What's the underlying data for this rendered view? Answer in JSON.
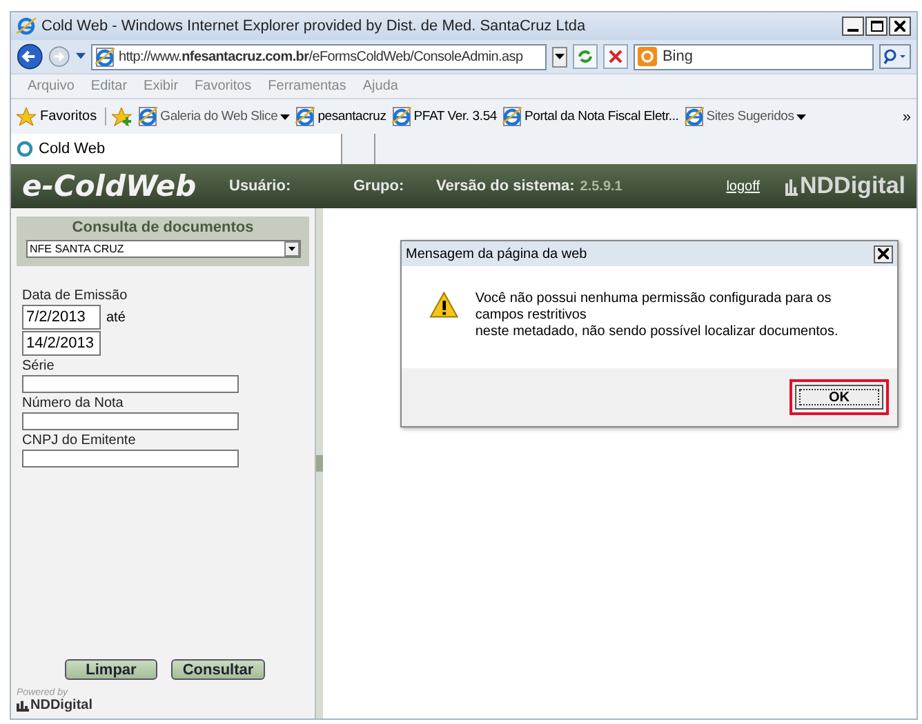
{
  "window": {
    "title": "Cold Web - Windows Internet Explorer provided by Dist. de Med. SantaCruz Ltda"
  },
  "address_bar": {
    "url": "http://www.**nfesantacruz.com.br**/eFormsColdWeb/ConsoleAdmin.asp",
    "search_placeholder": "Bing"
  },
  "menu": [
    "Arquivo",
    "Editar",
    "Exibir",
    "Favoritos",
    "Ferramentas",
    "Ajuda"
  ],
  "favorites_bar": {
    "label": "Favoritos",
    "items": [
      {
        "label": "Galeria do Web Slice",
        "dropdown": true,
        "dimmed": true
      },
      {
        "label": "pesantacruz",
        "dropdown": false,
        "dimmed": false
      },
      {
        "label": "PFAT Ver. 3.54",
        "dropdown": false,
        "dimmed": false
      },
      {
        "label": "Portal da Nota Fiscal Eletr...",
        "dropdown": false,
        "dimmed": false
      },
      {
        "label": "Sites Sugeridos",
        "dropdown": true,
        "dimmed": true
      }
    ],
    "overflow": "»"
  },
  "tabs": [
    {
      "label": "Cold Web",
      "selected": true
    }
  ],
  "app_header": {
    "logo": "e-ColdWeb",
    "user_label": "Usuário:",
    "group_label": "Grupo:",
    "version_label": "Versão do sistema:",
    "version": "2.5.9.1",
    "logoff": "logoff",
    "brand": "NDDigital"
  },
  "panel": {
    "title": "Consulta de documentos",
    "source": "NFE SANTA CRUZ",
    "date_label": "Data de Emissão",
    "date_from": "7/2/2013",
    "until": "até",
    "date_to": "14/2/2013",
    "fields": [
      {
        "label": "Série"
      },
      {
        "label": "Número da Nota"
      },
      {
        "label": "CNPJ do Emitente"
      }
    ],
    "buttons": [
      "Limpar",
      "Consultar"
    ],
    "powered_by": "Powered by",
    "powered_brand": "NDDigital"
  },
  "dialog": {
    "title": "Mensagem da página da web",
    "lines": [
      "Você não possui nenhuma permissão configurada para os campos restritivos",
      "neste metadado, não sendo possível localizar documentos."
    ],
    "button": "OK",
    "highlighted": true
  }
}
